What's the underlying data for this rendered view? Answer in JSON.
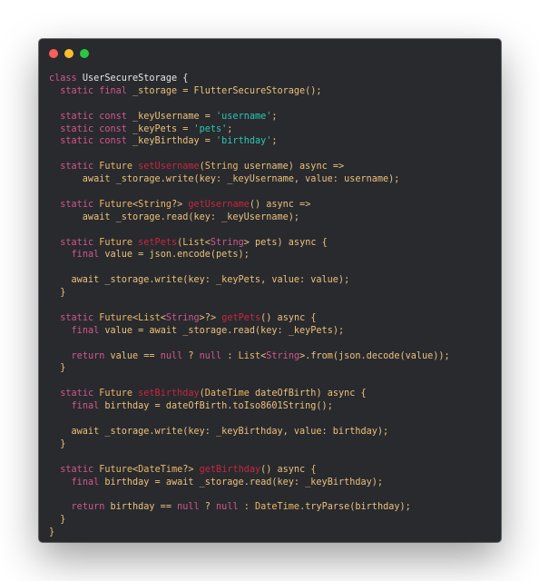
{
  "window": {
    "controls": [
      {
        "name": "close",
        "color": "#ff5f57"
      },
      {
        "name": "minimize",
        "color": "#febc2e"
      },
      {
        "name": "maximize",
        "color": "#28c840"
      }
    ]
  },
  "colors": {
    "background": "#282a2e",
    "keyword": "#d3578d",
    "type": "#eeb864",
    "function": "#c9263f",
    "string": "#2ec7b4",
    "plain": "#eec17a",
    "class_name": "#e8e8e8"
  },
  "code": {
    "language": "dart",
    "lines": [
      [
        [
          "kw",
          "class "
        ],
        [
          "cls",
          "UserSecureStorage {"
        ]
      ],
      [
        [
          "pl",
          "  "
        ],
        [
          "kw",
          "static final "
        ],
        [
          "pl",
          "_storage = FlutterSecureStorage();"
        ]
      ],
      [],
      [
        [
          "pl",
          "  "
        ],
        [
          "kw",
          "static const "
        ],
        [
          "pl",
          "_keyUsername = "
        ],
        [
          "str",
          "'username'"
        ],
        [
          "pl",
          ";"
        ]
      ],
      [
        [
          "pl",
          "  "
        ],
        [
          "kw",
          "static const "
        ],
        [
          "pl",
          "_keyPets = "
        ],
        [
          "str",
          "'pets'"
        ],
        [
          "pl",
          ";"
        ]
      ],
      [
        [
          "pl",
          "  "
        ],
        [
          "kw",
          "static const "
        ],
        [
          "pl",
          "_keyBirthday = "
        ],
        [
          "str",
          "'birthday'"
        ],
        [
          "pl",
          ";"
        ]
      ],
      [],
      [
        [
          "pl",
          "  "
        ],
        [
          "kw",
          "static "
        ],
        [
          "ty",
          "Future "
        ],
        [
          "fn",
          "setUsername"
        ],
        [
          "pl",
          "("
        ],
        [
          "ty",
          "String"
        ],
        [
          "pl",
          " username) async =>"
        ]
      ],
      [
        [
          "pl",
          "      await _storage.write(key: _keyUsername, value: username);"
        ]
      ],
      [],
      [
        [
          "pl",
          "  "
        ],
        [
          "kw",
          "static "
        ],
        [
          "ty",
          "Future"
        ],
        [
          "pl",
          "<"
        ],
        [
          "ty",
          "String"
        ],
        [
          "pl",
          "?> "
        ],
        [
          "fn",
          "getUsername"
        ],
        [
          "pl",
          "() async =>"
        ]
      ],
      [
        [
          "pl",
          "      await _storage.read(key: _keyUsername);"
        ]
      ],
      [],
      [
        [
          "pl",
          "  "
        ],
        [
          "kw",
          "static "
        ],
        [
          "ty",
          "Future "
        ],
        [
          "fn",
          "setPets"
        ],
        [
          "pl",
          "("
        ],
        [
          "ty",
          "List"
        ],
        [
          "pl",
          "<"
        ],
        [
          "kw",
          "String"
        ],
        [
          "pl",
          "> pets) async {"
        ]
      ],
      [
        [
          "pl",
          "    "
        ],
        [
          "kw",
          "final "
        ],
        [
          "pl",
          "value = json.encode(pets);"
        ]
      ],
      [],
      [
        [
          "pl",
          "    await _storage.write(key: _keyPets, value: value);"
        ]
      ],
      [
        [
          "pl",
          "  }"
        ]
      ],
      [],
      [
        [
          "pl",
          "  "
        ],
        [
          "kw",
          "static "
        ],
        [
          "ty",
          "Future"
        ],
        [
          "pl",
          "<"
        ],
        [
          "ty",
          "List"
        ],
        [
          "pl",
          "<"
        ],
        [
          "kw",
          "String"
        ],
        [
          "pl",
          ">?> "
        ],
        [
          "fn",
          "getPets"
        ],
        [
          "pl",
          "() async {"
        ]
      ],
      [
        [
          "pl",
          "    "
        ],
        [
          "kw",
          "final "
        ],
        [
          "pl",
          "value = await _storage.read(key: _keyPets);"
        ]
      ],
      [],
      [
        [
          "pl",
          "    "
        ],
        [
          "kw",
          "return "
        ],
        [
          "pl",
          "value == "
        ],
        [
          "kw",
          "null "
        ],
        [
          "pl",
          "? "
        ],
        [
          "kw",
          "null "
        ],
        [
          "pl",
          ": "
        ],
        [
          "ty",
          "List"
        ],
        [
          "pl",
          "<"
        ],
        [
          "kw",
          "String"
        ],
        [
          "pl",
          ">.from(json.decode(value));"
        ]
      ],
      [
        [
          "pl",
          "  }"
        ]
      ],
      [],
      [
        [
          "pl",
          "  "
        ],
        [
          "kw",
          "static "
        ],
        [
          "ty",
          "Future "
        ],
        [
          "fn",
          "setBirthday"
        ],
        [
          "pl",
          "("
        ],
        [
          "ty",
          "DateTime"
        ],
        [
          "pl",
          " dateOfBirth) async {"
        ]
      ],
      [
        [
          "pl",
          "    "
        ],
        [
          "kw",
          "final "
        ],
        [
          "pl",
          "birthday = dateOfBirth.toIso8601String();"
        ]
      ],
      [],
      [
        [
          "pl",
          "    await _storage.write(key: _keyBirthday, value: birthday);"
        ]
      ],
      [
        [
          "pl",
          "  }"
        ]
      ],
      [],
      [
        [
          "pl",
          "  "
        ],
        [
          "kw",
          "static "
        ],
        [
          "ty",
          "Future"
        ],
        [
          "pl",
          "<"
        ],
        [
          "ty",
          "DateTime"
        ],
        [
          "pl",
          "?> "
        ],
        [
          "fn",
          "getBirthday"
        ],
        [
          "pl",
          "() async {"
        ]
      ],
      [
        [
          "pl",
          "    "
        ],
        [
          "kw",
          "final "
        ],
        [
          "pl",
          "birthday = await _storage.read(key: _keyBirthday);"
        ]
      ],
      [],
      [
        [
          "pl",
          "    "
        ],
        [
          "kw",
          "return "
        ],
        [
          "pl",
          "birthday == "
        ],
        [
          "kw",
          "null "
        ],
        [
          "pl",
          "? "
        ],
        [
          "kw",
          "null "
        ],
        [
          "pl",
          ": "
        ],
        [
          "ty",
          "DateTime"
        ],
        [
          "pl",
          ".tryParse(birthday);"
        ]
      ],
      [
        [
          "pl",
          "  }"
        ]
      ],
      [
        [
          "pl",
          "}"
        ]
      ]
    ]
  }
}
